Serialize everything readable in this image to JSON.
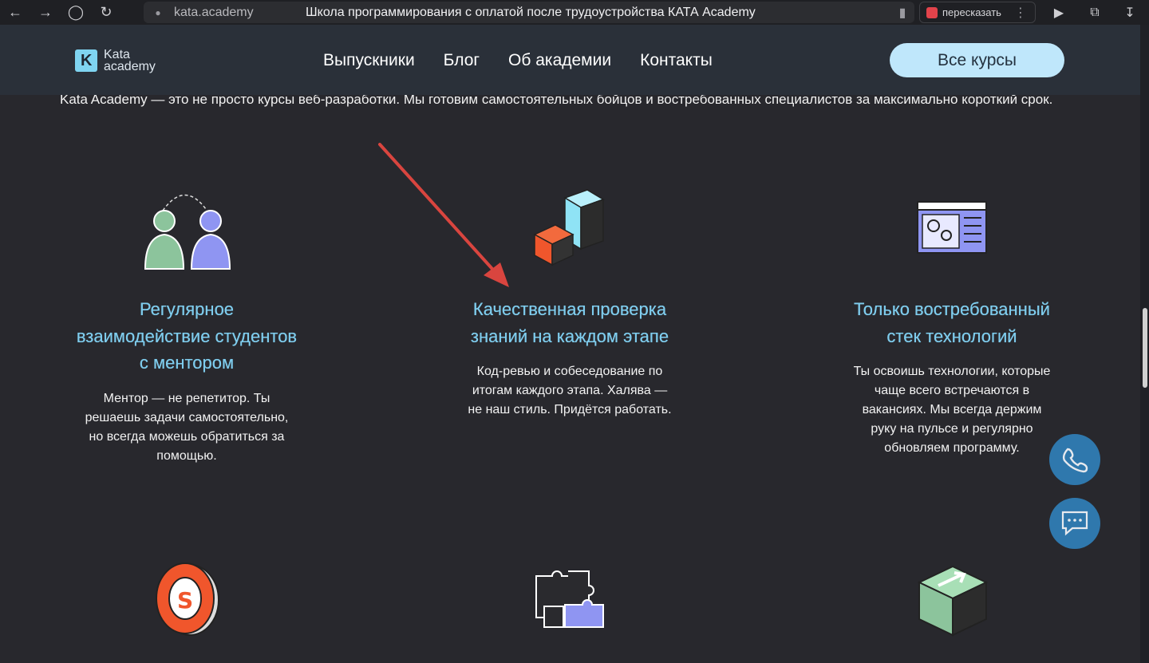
{
  "browser": {
    "url": "kata.academy",
    "title": "Школа программирования с оплатой после трудоустройства КАТА Academy",
    "retell_label": "пересказать"
  },
  "header": {
    "logo_line1": "Kata",
    "logo_line2": "academy",
    "nav": [
      "Выпускники",
      "Блог",
      "Об академии",
      "Контакты"
    ],
    "cta": "Все курсы"
  },
  "intro": "Kata Academy — это не просто курсы веб-разработки. Мы готовим самостоятельных бойцов и востребованных специалистов за максимально короткий срок.",
  "features": [
    {
      "title_lines": [
        "Регулярное",
        "взаимодействие студентов",
        "с ментором"
      ],
      "text_lines": [
        "Ментор — не репетитор. Ты",
        "решаешь задачи самостоятельно,",
        "но всегда можешь обратиться за",
        "помощью."
      ],
      "icon": "mentor-students-icon"
    },
    {
      "title_lines": [
        "Качественная проверка",
        "знаний на каждом этапе"
      ],
      "text_lines": [
        "Код-ревью и собеседование по",
        "итогам каждого этапа. Халява —",
        "не наш стиль. Придётся работать."
      ],
      "icon": "cubes-icon"
    },
    {
      "title_lines": [
        "Только востребованный",
        "стек технологий"
      ],
      "text_lines": [
        "Ты освоишь технологии, которые",
        "чаще всего встречаются в",
        "вакансиях. Мы всегда держим",
        "руку на пульсе и регулярно",
        "обновляем программу."
      ],
      "icon": "settings-window-icon"
    }
  ],
  "bottom_icons": [
    "coin-icon",
    "puzzle-icon",
    "box-arrow-icon"
  ],
  "colors": {
    "background": "#28282d",
    "header": "#2a3039",
    "accent": "#7fcdee",
    "cta": "#bfe7fb",
    "float": "#2f78ad",
    "annotation": "#d9453f"
  }
}
